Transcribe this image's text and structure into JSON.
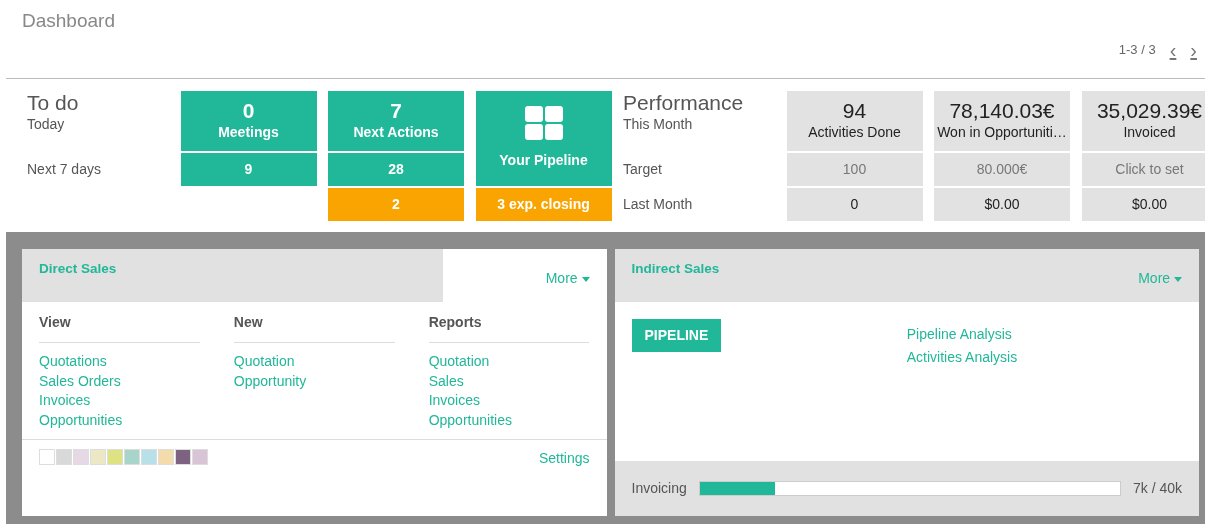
{
  "title": "Dashboard",
  "pager": {
    "text": "1-3 / 3",
    "prev": "‹",
    "next": "›"
  },
  "todo": {
    "title": "To do",
    "row_labels": [
      "Today",
      "Next 7 days"
    ],
    "tiles": [
      {
        "kind": "count",
        "value": "0",
        "label": "Meetings",
        "next_7_days": "9"
      },
      {
        "kind": "count",
        "value": "7",
        "label": "Next Actions",
        "next_7_days": "28",
        "overdue": "2"
      },
      {
        "kind": "pipeline",
        "label": "Your Pipeline",
        "overdue": "3 exp. closing"
      }
    ]
  },
  "performance": {
    "title": "Performance",
    "row_labels": [
      "This Month",
      "Target",
      "Last Month"
    ],
    "tiles": [
      {
        "value": "94",
        "label": "Activities Done",
        "target": "100",
        "last_month": "0"
      },
      {
        "value": "78,140.03€",
        "label": "Won in Opportuniti…",
        "target": "80.000€",
        "last_month": "$0.00"
      },
      {
        "value": "35,029.39€",
        "label": "Invoiced",
        "target": "Click to set",
        "last_month": "$0.00"
      }
    ]
  },
  "direct_sales": {
    "title": "Direct Sales",
    "title_highlighted": true,
    "more": "More",
    "columns": [
      {
        "heading": "View",
        "links": [
          "Quotations",
          "Sales Orders",
          "Invoices",
          "Opportunities"
        ]
      },
      {
        "heading": "New",
        "links": [
          "Quotation",
          "Opportunity"
        ]
      },
      {
        "heading": "Reports",
        "links": [
          "Quotation",
          "Sales",
          "Invoices",
          "Opportunities"
        ]
      }
    ],
    "swatches": [
      {
        "color": "#ffffff"
      },
      {
        "color": "#d9d9d9"
      },
      {
        "color": "#e6d8e5"
      },
      {
        "color": "#ece8c6"
      },
      {
        "color": "#dde282"
      },
      {
        "color": "#a8d5c9"
      },
      {
        "color": "#b8e0e8"
      },
      {
        "color": "#f3dbac"
      },
      {
        "color": "#7d6381"
      },
      {
        "color": "#d9c3d7"
      }
    ],
    "settings": "Settings"
  },
  "indirect_sales": {
    "title": "Indirect Sales",
    "title_highlighted": false,
    "more": "More",
    "button": "PIPELINE",
    "links": [
      "Pipeline Analysis",
      "Activities Analysis"
    ],
    "progress": {
      "label": "Invoicing",
      "level": 0.18,
      "reading": "7k / 40k"
    }
  }
}
